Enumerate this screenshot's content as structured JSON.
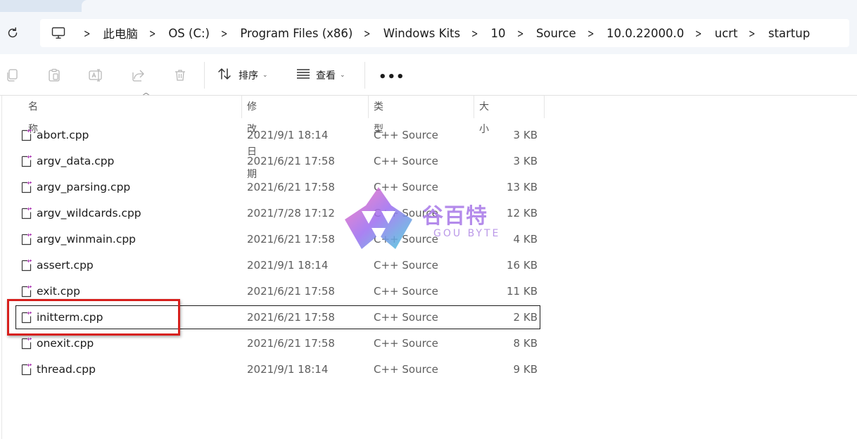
{
  "breadcrumb": [
    "此电脑",
    "OS (C:)",
    "Program Files (x86)",
    "Windows Kits",
    "10",
    "Source",
    "10.0.22000.0",
    "ucrt",
    "startup"
  ],
  "toolbar": {
    "sort_label": "排序",
    "view_label": "查看",
    "more_label": "•••"
  },
  "columns": {
    "name": "名称",
    "modified": "修改日期",
    "type": "类型",
    "size": "大小"
  },
  "files": [
    {
      "name": "abort.cpp",
      "modified": "2021/9/1 18:14",
      "type": "C++ Source",
      "size": "3 KB"
    },
    {
      "name": "argv_data.cpp",
      "modified": "2021/6/21 17:58",
      "type": "C++ Source",
      "size": "3 KB"
    },
    {
      "name": "argv_parsing.cpp",
      "modified": "2021/6/21 17:58",
      "type": "C++ Source",
      "size": "13 KB"
    },
    {
      "name": "argv_wildcards.cpp",
      "modified": "2021/7/28 17:12",
      "type": "C++ Source",
      "size": "12 KB"
    },
    {
      "name": "argv_winmain.cpp",
      "modified": "2021/6/21 17:58",
      "type": "C++ Source",
      "size": "4 KB"
    },
    {
      "name": "assert.cpp",
      "modified": "2021/9/1 18:14",
      "type": "C++ Source",
      "size": "16 KB"
    },
    {
      "name": "exit.cpp",
      "modified": "2021/6/21 17:58",
      "type": "C++ Source",
      "size": "11 KB"
    },
    {
      "name": "initterm.cpp",
      "modified": "2021/6/21 17:58",
      "type": "C++ Source",
      "size": "2 KB"
    },
    {
      "name": "onexit.cpp",
      "modified": "2021/6/21 17:58",
      "type": "C++ Source",
      "size": "8 KB"
    },
    {
      "name": "thread.cpp",
      "modified": "2021/9/1 18:14",
      "type": "C++ Source",
      "size": "9 KB"
    }
  ],
  "watermark": {
    "title": "谷百特",
    "subtitle": "GOU BYTE"
  },
  "colors": {
    "highlight": "#d7201d",
    "window_bg": "#f3f6fa",
    "tab_strip": "#dce6f2"
  }
}
